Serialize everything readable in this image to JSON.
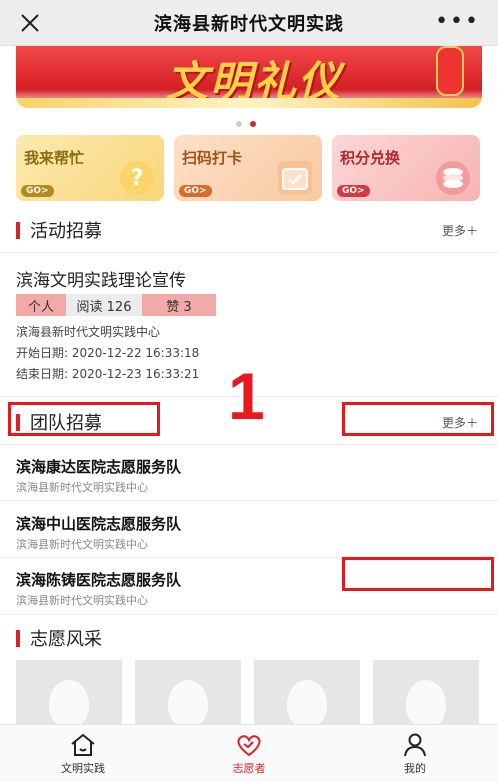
{
  "header": {
    "title": "滨海县新时代文明实践"
  },
  "banner": {
    "text": "文明礼仪"
  },
  "quick_links": [
    {
      "label": "我来帮忙",
      "go": "GO>",
      "icon": "question-icon"
    },
    {
      "label": "扫码打卡",
      "go": "GO>",
      "icon": "calendar-check-icon"
    },
    {
      "label": "积分兑换",
      "go": "GO>",
      "icon": "coin-stack-icon"
    }
  ],
  "recruit": {
    "title": "活动招募",
    "more": "更多＋",
    "activity": {
      "title": "滨海文明实践理论宣传",
      "tag_person": "个人",
      "read": "阅读  126",
      "like": "赞  3",
      "org": "滨海县新时代文明实践中心",
      "start": "开始日期: 2020-12-22 16:33:18",
      "end": "结束日期: 2020-12-23 16:33:21"
    }
  },
  "team": {
    "title": "团队招募",
    "more": "更多＋",
    "items": [
      {
        "name": "滨海康达医院志愿服务队",
        "org": "滨海县新时代文明实践中心"
      },
      {
        "name": "滨海中山医院志愿服务队",
        "org": "滨海县新时代文明实践中心"
      },
      {
        "name": "滨海陈铸医院志愿服务队",
        "org": "滨海县新时代文明实践中心"
      }
    ]
  },
  "style_section": {
    "title": "志愿风采"
  },
  "annotation": {
    "marker": "1"
  },
  "tabbar": [
    {
      "label": "文明实践",
      "icon": "home-icon"
    },
    {
      "label": "志愿者",
      "icon": "heart-icon"
    },
    {
      "label": "我的",
      "icon": "user-icon"
    }
  ],
  "colors": {
    "accent": "#d8232a",
    "annotation": "#e8191e"
  }
}
